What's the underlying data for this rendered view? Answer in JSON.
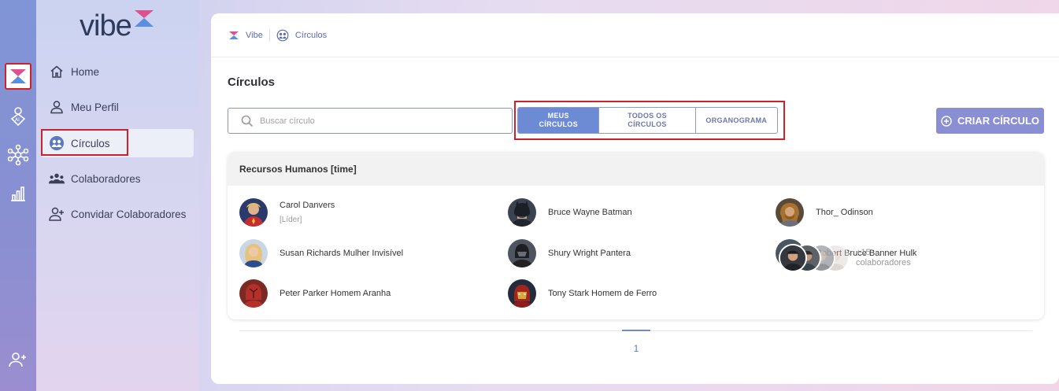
{
  "app": {
    "logo_text": "vibe"
  },
  "sidebar": {
    "items": [
      {
        "label": "Home",
        "icon": "home-icon"
      },
      {
        "label": "Meu Perfil",
        "icon": "user-icon"
      },
      {
        "label": "Círculos",
        "icon": "circles-icon",
        "active": true
      },
      {
        "label": "Colaboradores",
        "icon": "group-icon"
      },
      {
        "label": "Convidar Colaboradores",
        "icon": "user-plus-icon"
      }
    ]
  },
  "rail": {
    "items": [
      "vibe-app-icon",
      "ai-icon",
      "network-icon",
      "chart-icon"
    ],
    "bottom": "user-plus-icon"
  },
  "breadcrumb": {
    "root": "Vibe",
    "current": "Círculos"
  },
  "page": {
    "title": "Círculos"
  },
  "search": {
    "placeholder": "Buscar círculo",
    "value": ""
  },
  "segmented": {
    "options": [
      {
        "line1": "MEUS",
        "line2": "CÍRCULOS",
        "active": true
      },
      {
        "line1": "TODOS OS",
        "line2": "CÍRCULOS",
        "active": false
      },
      {
        "line1": "ORGANOGRAMA",
        "line2": "",
        "active": false
      }
    ]
  },
  "create_button": {
    "label": "CRIAR CÍRCULO"
  },
  "circle": {
    "title": "Recursos Humanos [time]",
    "members": [
      {
        "name": "Carol Danvers",
        "role": "[Líder]"
      },
      {
        "name": "Bruce Wayne Batman",
        "role": ""
      },
      {
        "name": "Thor_ Odinson",
        "role": ""
      },
      {
        "name": "Susan Richards Mulher Invisível",
        "role": ""
      },
      {
        "name": "Shury Wright Pantera",
        "role": ""
      },
      {
        "name": "Robert Bruce Banner Hulk",
        "role": ""
      },
      {
        "name": "Peter Parker Homem Aranha",
        "role": ""
      },
      {
        "name": "Tony Stark Homem de Ferro",
        "role": ""
      }
    ],
    "more": {
      "count": "+15",
      "label": "colaboradores"
    }
  },
  "pagination": {
    "current": "1"
  },
  "colors": {
    "accent": "#6c8bd4",
    "brand_pink": "#e0508e",
    "brand_blue": "#5b8ee0",
    "highlight": "#d0212b"
  }
}
